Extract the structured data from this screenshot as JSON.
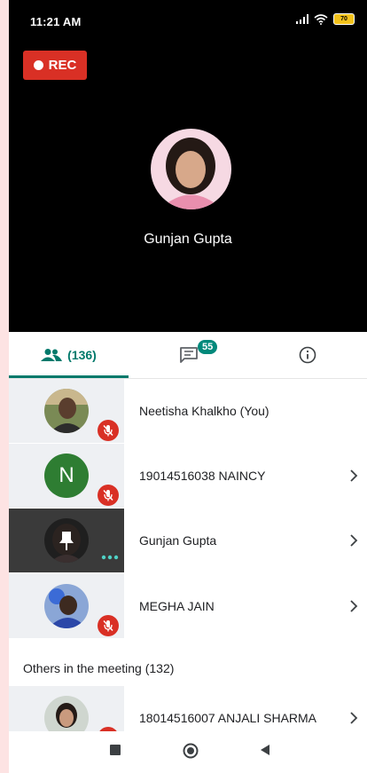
{
  "status_bar": {
    "time": "11:21 AM",
    "battery": "70"
  },
  "recording": {
    "label": "REC"
  },
  "active_speaker": {
    "name": "Gunjan Gupta"
  },
  "tabs": {
    "people_count": "(136)",
    "chat_badge": "55"
  },
  "participants": [
    {
      "name": "Neetisha Khalkho (You)",
      "muted": true,
      "has_chevron": false
    },
    {
      "name": "19014516038 NAINCY",
      "initial": "N",
      "muted": true,
      "has_chevron": true
    },
    {
      "name": "Gunjan Gupta",
      "pinned": true,
      "has_chevron": true
    },
    {
      "name": "MEGHA JAIN",
      "muted": true,
      "has_chevron": true
    }
  ],
  "others": {
    "title": "Others in the meeting (132)",
    "items": [
      {
        "name": "18014516007 ANJALI SHARMA",
        "muted": true,
        "has_chevron": true
      }
    ]
  },
  "colors": {
    "accent": "#00796b",
    "rec_red": "#d93025",
    "avatar_green": "#2e7d32"
  }
}
